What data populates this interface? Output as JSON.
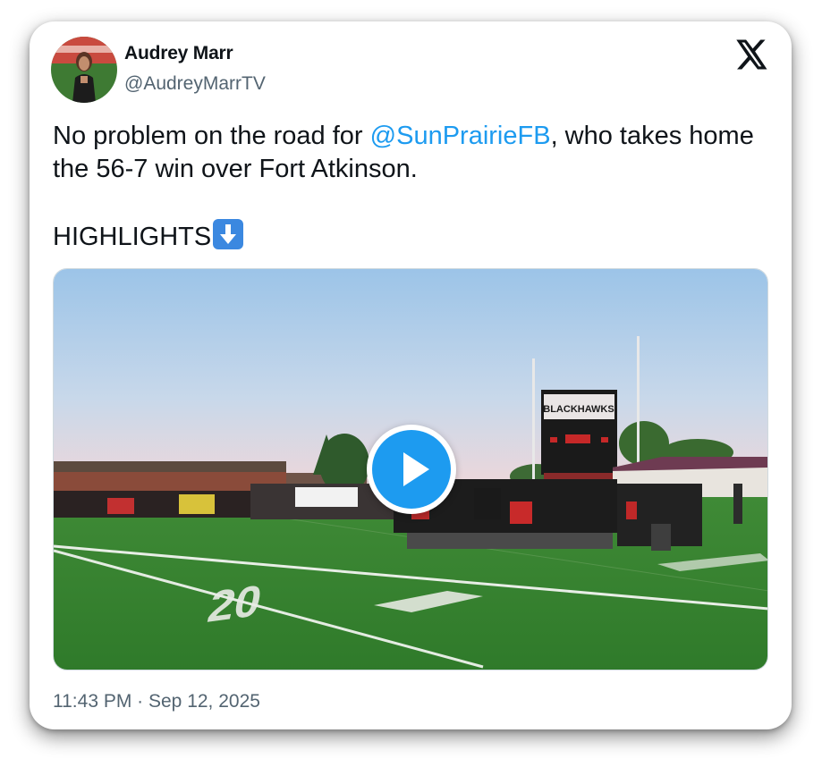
{
  "author": {
    "display_name": "Audrey Marr",
    "handle": "@AudreyMarrTV"
  },
  "logo_icon": "x-logo-icon",
  "tweet": {
    "text_before_mention": "No problem on the road for ",
    "mention": "@SunPrairieFB",
    "text_after_mention": ", who takes home the 56-7 win over Fort Atkinson.",
    "highlights": "HIGHLIGHTS",
    "emoji": "down-arrow-emoji-icon"
  },
  "media": {
    "type": "video",
    "scoreboard_text": "BLACKHAWKS",
    "yard_marker": "20"
  },
  "timestamp": "11:43 PM · Sep 12, 2025",
  "colors": {
    "mention": "#1d9bf0",
    "play_button": "#1d9bf0",
    "text": "#0f1419",
    "secondary": "#536471"
  }
}
